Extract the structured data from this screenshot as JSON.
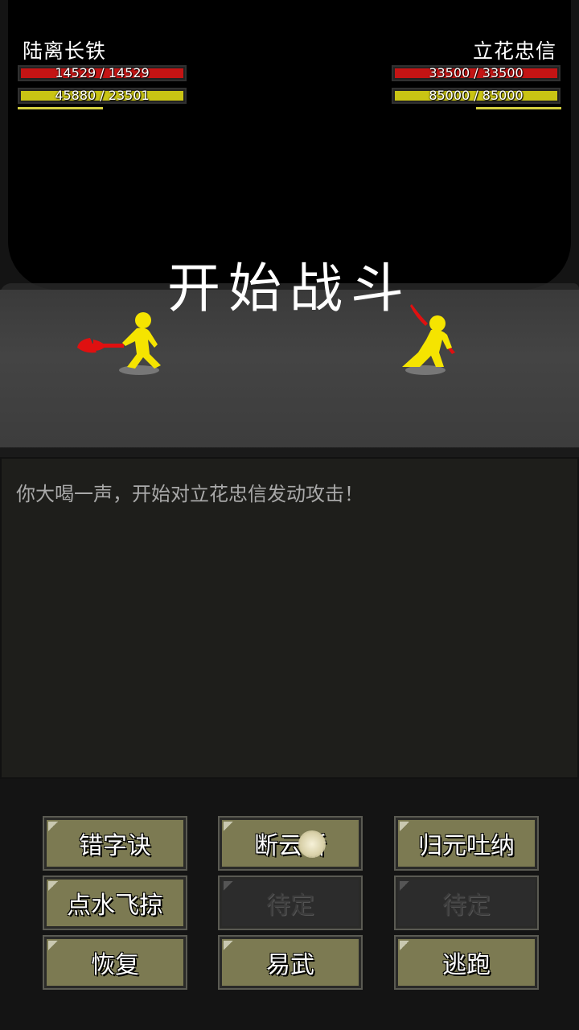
{
  "player": {
    "name": "陆离长铁",
    "hp_text": "14529 / 14529",
    "hp_ratio": 1.0,
    "mp_text": "45880 / 23501",
    "mp_ratio": 1.0
  },
  "enemy": {
    "name": "立花忠信",
    "hp_text": "33500 / 33500",
    "hp_ratio": 1.0,
    "mp_text": "85000 / 85000",
    "mp_ratio": 1.0
  },
  "battle": {
    "banner": "开始战斗"
  },
  "log": {
    "lines": [
      "你大喝一声，开始对立花忠信发动攻击！"
    ]
  },
  "skills": [
    {
      "label": "错字诀",
      "enabled": true
    },
    {
      "label": "断云斩",
      "enabled": true
    },
    {
      "label": "归元吐纳",
      "enabled": true
    },
    {
      "label": "点水飞掠",
      "enabled": true
    },
    {
      "label": "待定",
      "enabled": false
    },
    {
      "label": "待定",
      "enabled": false
    },
    {
      "label": "恢复",
      "enabled": true
    },
    {
      "label": "易武",
      "enabled": true
    },
    {
      "label": "逃跑",
      "enabled": true
    }
  ],
  "colors": {
    "hp": "#c41414",
    "mp": "#c9c414",
    "fighter": "#f5e400",
    "weapon": "#e01010"
  },
  "icons": {
    "player_weapon": "battle-axe-icon",
    "enemy_weapon": "red-sword-icon"
  }
}
